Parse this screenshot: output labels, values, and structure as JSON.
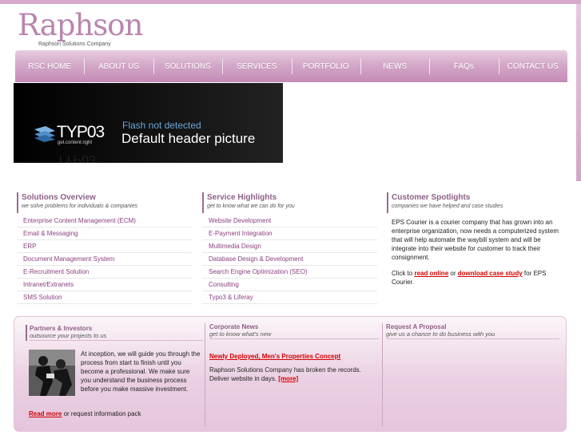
{
  "brand": {
    "logo": "Raphson",
    "tagline": "Raphson Solutions Company"
  },
  "nav": {
    "items": [
      "RSC HOME",
      "ABOUT US",
      "SOLUTIONS",
      "SERVICES",
      "PORTFOLIO",
      "NEWS",
      "FAQs",
      "CONTACT US"
    ]
  },
  "header": {
    "brand": "TYP03",
    "brand_tag": "get.content.right",
    "flash_message": "Flash not detected",
    "caption": "Default header picture"
  },
  "solutions": {
    "title": "Solutions Overview",
    "subtitle": "we solve problems for individuals & companies",
    "items": [
      "Enterprise Content Management (ECM)",
      "Email & Messaging",
      "ERP",
      "Document Management System",
      "E-Recruitment Solution",
      "Intranet/Extranets",
      "SMS Solution"
    ]
  },
  "services": {
    "title": "Service Highlights",
    "subtitle": "get to know what we can do for you",
    "items": [
      "Website Development",
      "E-Payment Integration",
      "Multimedia Design",
      "Database Design & Development",
      "Search Engine Optimization (SEO)",
      "Consulting",
      "Typo3 & Liferay"
    ]
  },
  "spotlights": {
    "title": "Customer Spotlights",
    "subtitle": "companies we have helped and case studies",
    "body": "EPS Courier is a courier company that has grown into an enterprise organization, now needs a computerized system that will help automate the waybill system and will be integrate into their website for customer to track their consignment.",
    "click_prefix": "Click to",
    "read_online": "read online",
    "or_text": "or",
    "download": "download case study",
    "suffix": "for EPS Courier."
  },
  "partners": {
    "title": "Partners & Investors",
    "subtitle": "outsource your projects to us",
    "body": "At inception, we will guide you through the process from start to finish until you become a professional. We make sure you understand the business process before you make massive investment.",
    "read_more": "Read more",
    "read_more_suffix": "or request information pack"
  },
  "news": {
    "title": "Corporate News",
    "subtitle": "get to know what's new",
    "headline": "Newly Deployed, Men's Properties Concept",
    "body": "Raphson Solutions Company has broken the records. Deliver website in days.",
    "more": "[more]"
  },
  "proposal": {
    "title": "Request A Proposal",
    "subtitle": "give us a chance to do business with you"
  },
  "colors": {
    "accent": "#8d5f85",
    "link_red": "#d40000",
    "nav_pink": "#d4a9c9"
  }
}
